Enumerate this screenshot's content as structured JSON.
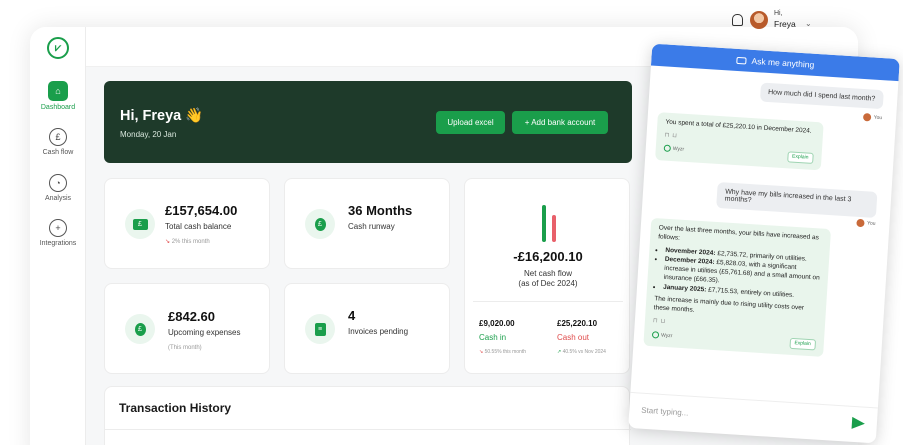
{
  "sidebar": {
    "logo": "wyzr-logo",
    "items": [
      {
        "label": "Dashboard",
        "icon": "home-icon",
        "active": true
      },
      {
        "label": "Cash flow",
        "icon": "pound-icon"
      },
      {
        "label": "Analysis",
        "icon": "pie-chart-icon"
      },
      {
        "label": "Integrations",
        "icon": "plus-circle-icon"
      }
    ]
  },
  "topbar": {
    "greeting_small": "Hi,",
    "user_name": "Freya"
  },
  "hero": {
    "greeting": "Hi, Freya 👋",
    "date": "Monday, 20 Jan",
    "upload_label": "Upload excel",
    "add_bank_label": "+ Add bank account"
  },
  "cards": {
    "balance": {
      "value": "£157,654.00",
      "label": "Total cash balance",
      "change": "2% this month"
    },
    "runway": {
      "value": "36 Months",
      "label": "Cash runway"
    },
    "upcoming": {
      "value": "£842.60",
      "label": "Upcoming expenses",
      "sub": "(This month)"
    },
    "invoices": {
      "value": "4",
      "label": "Invoices pending"
    },
    "net": {
      "value": "-£16,200.10",
      "label_line1": "Net cash flow",
      "label_line2": "(as of Dec 2024)",
      "cash_in_value": "£9,020.00",
      "cash_in_label": "Cash in",
      "cash_in_change": "50.55% this month",
      "cash_out_value": "£25,220.10",
      "cash_out_label": "Cash out",
      "cash_out_change": "40.5% vs Nov 2024",
      "bar_in_level": 0.72,
      "bar_out_level": 0.52
    }
  },
  "transactions": {
    "title": "Transaction History"
  },
  "chat": {
    "header": "Ask me anything",
    "q1": "How much did I spend last month?",
    "you": "You",
    "a1": "You spent a total of £25,220.10 in December 2024.",
    "bot_name": "Wyzr",
    "explain": "Explain",
    "q2": "Why have my bills increased in the last 3 months?",
    "a2_intro": "Over the last three months, your bills have increased as follows:",
    "a2_b1_bold": "November 2024:",
    "a2_b1": " £2,735.72, primarily on utilities.",
    "a2_b2_bold": "December 2024:",
    "a2_b2": " £5,828.03, with a significant increase in utilities (£5,761.68) and a small amount on insurance (£66.35).",
    "a2_b3_bold": "January 2025:",
    "a2_b3": " £7,715.53, entirely on utilities.",
    "a2_outro": "The increase is mainly due to rising utility costs over these months.",
    "input_placeholder": "Start typing..."
  },
  "colors": {
    "brand": "#1a9e4b",
    "hero_bg": "#1e3a2a",
    "chat_header": "#3b7be8",
    "cash_out": "#e8606a"
  }
}
